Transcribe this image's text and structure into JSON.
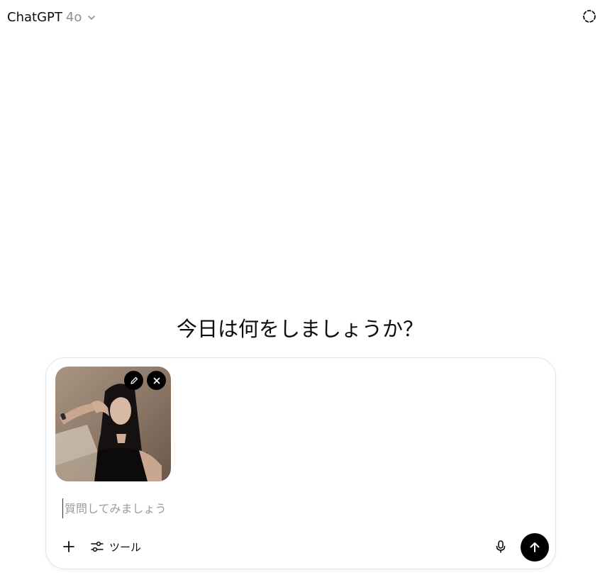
{
  "header": {
    "model_name": "ChatGPT",
    "model_version": "4o",
    "model_chevron_icon": "chevron-down-icon",
    "temporary_chat_icon": "dashed-circle-icon"
  },
  "main": {
    "greeting": "今日は何をしましょうか？"
  },
  "composer": {
    "attachment": {
      "type": "image",
      "subject": "photo of a person with long dark hair",
      "edit_icon": "pencil-icon",
      "remove_icon": "close-icon"
    },
    "input_value": "",
    "input_placeholder": "質問してみましょう",
    "add_icon": "plus-icon",
    "tools_icon": "sliders-icon",
    "tools_label": "ツール",
    "mic_icon": "microphone-icon",
    "send_icon": "arrow-up-icon"
  },
  "colors": {
    "send_button_bg": "#000000",
    "placeholder": "#9b9b9b",
    "border": "#e3e3e3"
  }
}
